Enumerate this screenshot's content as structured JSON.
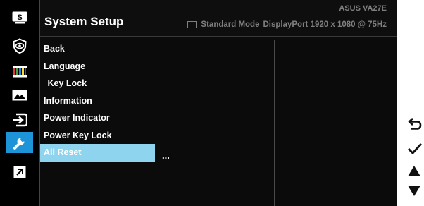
{
  "header": {
    "title": "System Setup",
    "model": "ASUS  VA27E",
    "mode": "Standard Mode",
    "signal": "DisplayPort 1920 x 1080 @ 75Hz"
  },
  "iconbar": {
    "items": [
      {
        "icon": "splendid-icon",
        "label": "S"
      },
      {
        "icon": "eye-care-icon"
      },
      {
        "icon": "color-icon"
      },
      {
        "icon": "image-icon"
      },
      {
        "icon": "input-select-icon"
      },
      {
        "icon": "wrench-icon",
        "selected": true
      },
      {
        "icon": "shortcut-icon"
      }
    ]
  },
  "menu": {
    "items": [
      {
        "label": "Back"
      },
      {
        "label": "Language"
      },
      {
        "label": " Key Lock"
      },
      {
        "label": "Information"
      },
      {
        "label": "Power Indicator"
      },
      {
        "label": "Power Key Lock"
      },
      {
        "label": "All Reset",
        "selected": true
      }
    ]
  },
  "submenu": {
    "value": "..."
  },
  "keys": [
    {
      "icon": "back-arrow-icon"
    },
    {
      "icon": "checkmark-icon"
    },
    {
      "icon": "triangle-up-icon"
    },
    {
      "icon": "triangle-down-icon"
    }
  ],
  "colors": {
    "accent": "#1d94d8",
    "selected_row": "#8fd4ef",
    "background": "#0b0b0b",
    "dim_text": "#7f7f7f"
  }
}
